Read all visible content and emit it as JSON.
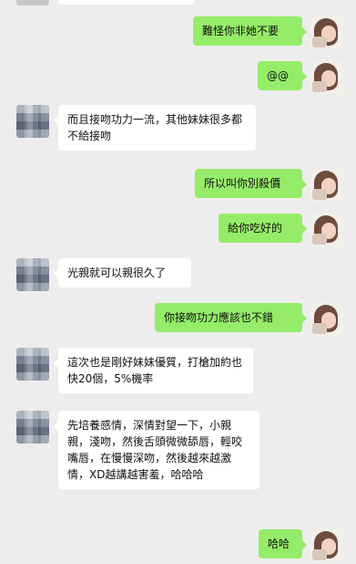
{
  "messages": [
    {
      "side": "right",
      "text": "難怪你非她不要"
    },
    {
      "side": "right",
      "text": "@@"
    },
    {
      "side": "left",
      "text": "而且接吻功力一流，其他妹妹很多都不給接吻"
    },
    {
      "side": "right",
      "text": "所以叫你別殺價"
    },
    {
      "side": "right",
      "text": "給你吃好的"
    },
    {
      "side": "left",
      "text": "光親就可以親很久了"
    },
    {
      "side": "right",
      "text": "你接吻功力應該也不錯"
    },
    {
      "side": "left",
      "text": "這次也是剛好妹妹優質，打槍加約也快20個，5%機率"
    },
    {
      "side": "left",
      "text": "先培養感情，深情對望一下，小親親，淺吻，然後舌頭微微舔唇，輕咬嘴唇，在慢慢深吻，然後越來越激情，XD越講越害羞，哈哈哈"
    },
    {
      "side": "right",
      "text": "哈哈"
    }
  ]
}
